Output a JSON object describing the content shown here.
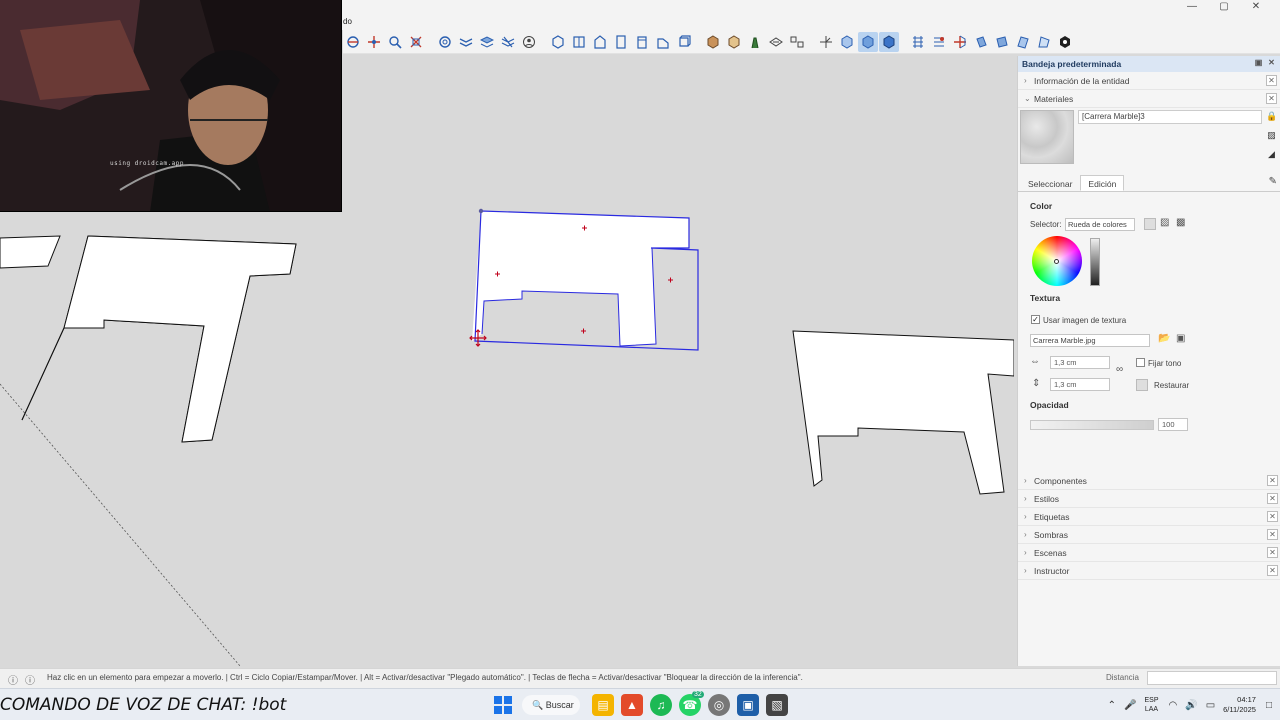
{
  "window": {
    "menu_fragment": "do",
    "controls": [
      "—",
      "▢",
      "✕"
    ]
  },
  "overlay": {
    "webcam_caption": "using droidcam.app",
    "chat_command": "COMANDO DE VOZ DE CHAT: !bot"
  },
  "toolbar": {
    "icons": [
      "orbit-icon",
      "pan-icon",
      "zoom-icon",
      "zoom-extents-icon",
      "section-icon",
      "styles-icon",
      "layers-icon",
      "shadow-icon",
      "person-icon",
      "iso-view-icon",
      "top-view-icon",
      "front-view-icon",
      "right-view-icon",
      "back-view-icon",
      "left-view-icon",
      "box-icon",
      "component-icon",
      "paint-icon",
      "material-icon",
      "sandbox-icon",
      "move-icon",
      "follow-icon",
      "xray-icon",
      "back-edges-icon",
      "wireframe-icon",
      "hidden-line-icon",
      "shaded-icon",
      "textured-icon",
      "monochrome-icon",
      "extension-icon"
    ]
  },
  "tray": {
    "title": "Bandeja predeterminada",
    "entity_info": "Información de la entidad",
    "materials": "Materiales",
    "material_name": "[Carrera Marble]3",
    "tabs": [
      "Seleccionar",
      "Edición"
    ],
    "active_tab": "Edición",
    "color_heading": "Color",
    "selector_label": "Selector:",
    "selector_value": "Rueda de colores",
    "texture_heading": "Textura",
    "use_texture_label": "Usar imagen de textura",
    "texture_file": "Carrera Marble.jpg",
    "width_value": "1,3 cm",
    "height_value": "1,3 cm",
    "fix_tone_label": "Fijar tono",
    "restore_label": "Restaurar",
    "opacity_heading": "Opacidad",
    "opacity_value": "100",
    "collapsed_panels": [
      "Componentes",
      "Estilos",
      "Etiquetas",
      "Sombras",
      "Escenas",
      "Instructor"
    ]
  },
  "status": {
    "hint": "Haz clic en un elemento para empezar a moverlo. | Ctrl = Ciclo Copiar/Estampar/Mover. | Alt = Activar/desactivar \"Plegado automático\". | Teclas de flecha = Activar/desactivar \"Bloquear la dirección de la inferencia\".",
    "measure_label": "Distancia",
    "measure_value": ""
  },
  "taskbar": {
    "search_label": "Buscar",
    "badge_count": "32",
    "lang_top": "ESP",
    "lang_bottom": "LAA",
    "time": "04:17",
    "date": "6/11/2025"
  },
  "colors": {
    "selection_blue": "#2a2ae0",
    "viewport_bg": "#d9d9d9",
    "tray_header_bg": "#dbe6f4",
    "taskbar_bg": "#e9edf3"
  }
}
